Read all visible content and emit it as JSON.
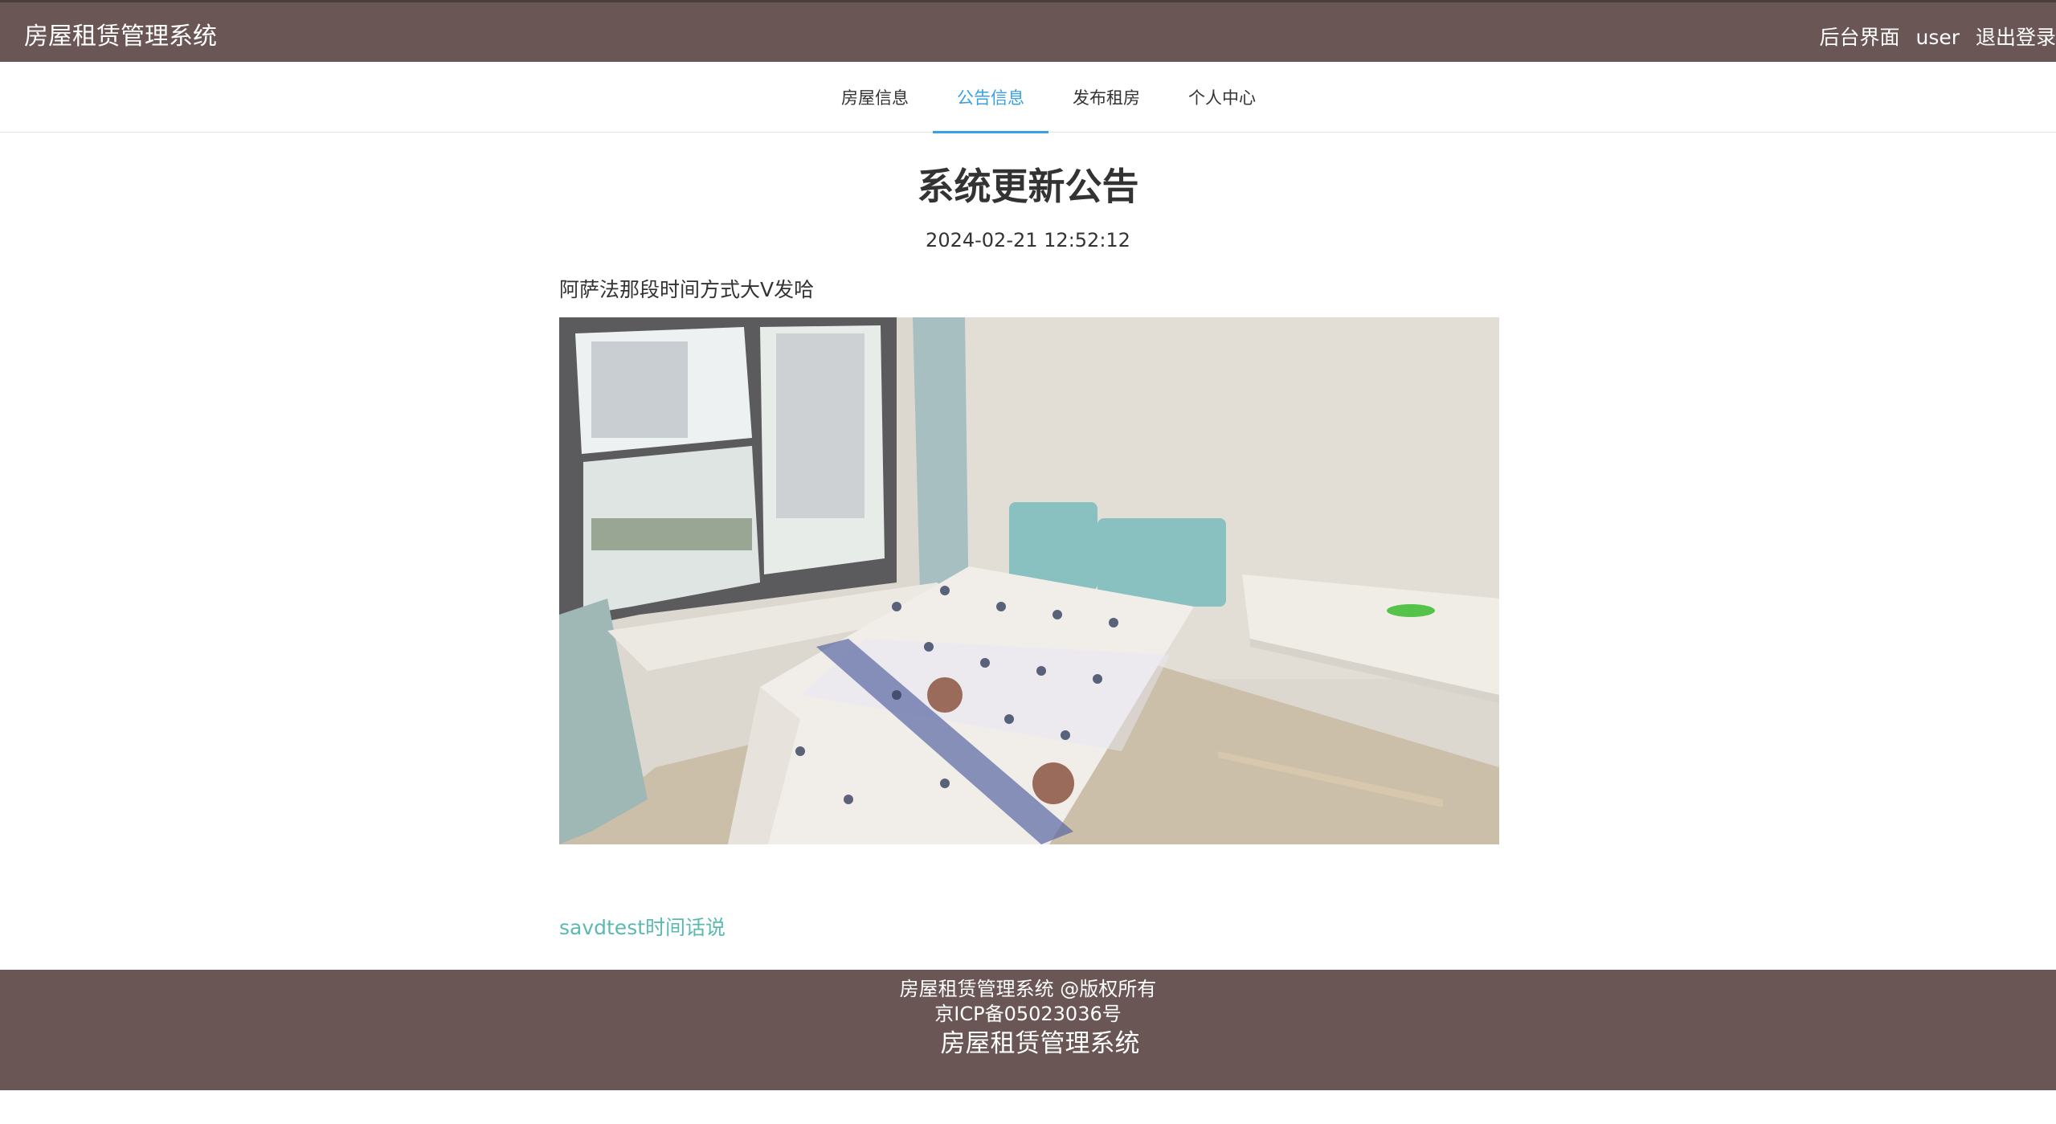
{
  "header": {
    "brand": "房屋租赁管理系统",
    "links": [
      "后台界面",
      "user",
      "退出登录"
    ]
  },
  "nav": {
    "items": [
      "房屋信息",
      "公告信息",
      "发布租房",
      "个人中心"
    ],
    "active": "公告信息"
  },
  "article": {
    "title": "系统更新公告",
    "date": "2024-02-21 12:52:12",
    "text": "阿萨法那段时间方式大V发哈",
    "link": "savdtest时间话说"
  },
  "footer": {
    "line1": "房屋租赁管理系统 @版权所有",
    "line2": "京ICP备05023036号",
    "line3": "房屋租赁管理系统"
  },
  "colors": {
    "header_bg": "#6b5656",
    "active_nav": "#3aa0e3",
    "link": "#5bbab0"
  }
}
